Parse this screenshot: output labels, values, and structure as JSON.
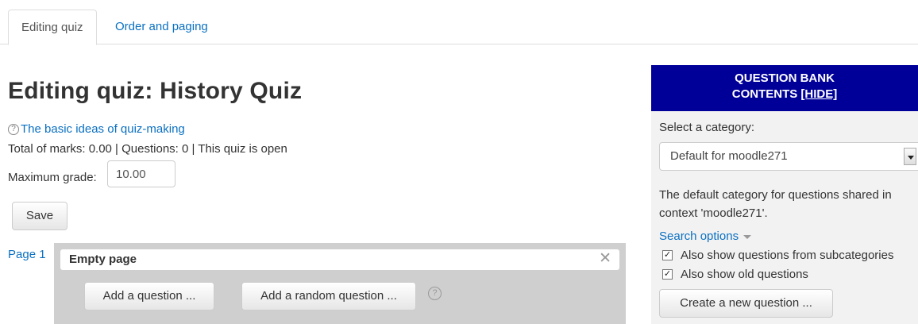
{
  "tabs": [
    {
      "label": "Editing quiz"
    },
    {
      "label": "Order and paging"
    }
  ],
  "main": {
    "title": "Editing quiz: History Quiz",
    "help_link": "The basic ideas of quiz-making",
    "info": "Total of marks: 0.00 | Questions: 0 | This quiz is open",
    "max_grade_label": "Maximum grade:",
    "max_grade_value": "10.00",
    "save_label": "Save",
    "page_label": "Page 1",
    "section_heading": "Empty page",
    "add_question_label": "Add a question ...",
    "add_random_label": "Add a random question ..."
  },
  "question_bank": {
    "header_line1": "QUESTION BANK",
    "header_line2": "CONTENTS",
    "hide_label": "[HIDE]",
    "select_label": "Select a category:",
    "selected_category": "Default for moodle271",
    "description": "The default category for questions shared in context 'moodle271'.",
    "search_options": "Search options",
    "checkbox_subcategories": "Also show questions from subcategories",
    "checkbox_old": "Also show old questions",
    "create_label": "Create a new question ..."
  },
  "colors": {
    "link": "#0a70c2",
    "panel_header": "#000099",
    "page_box": "#cfcfcf"
  },
  "icons": [
    "help-icon",
    "close-icon",
    "dropdown-arrow-icon",
    "caret-down-icon",
    "checkbox-checked-icon"
  ]
}
